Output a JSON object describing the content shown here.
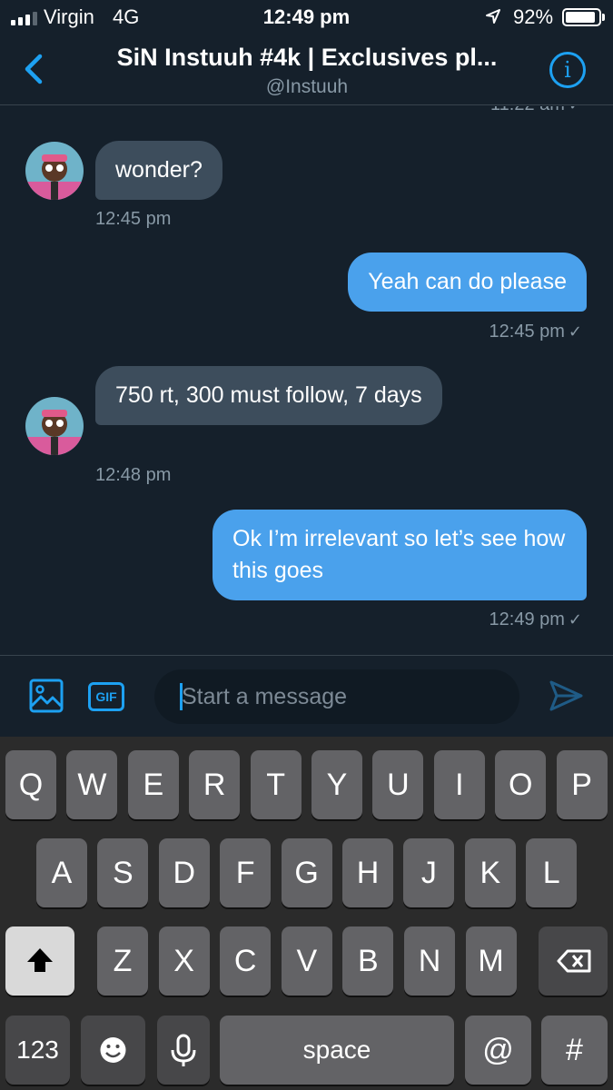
{
  "status_bar": {
    "carrier": "Virgin",
    "network": "4G",
    "time": "12:49 pm",
    "battery_percent": "92%",
    "battery_level": 0.92
  },
  "header": {
    "title": "SiN Instuuh #4k | Exclusives pl...",
    "handle": "@Instuuh",
    "back_icon": "chevron-left-icon",
    "info_icon": "info-icon"
  },
  "messages": {
    "cut_off_time": "11:22 am",
    "items": [
      {
        "direction": "in",
        "text": "wonder?",
        "time": "12:45 pm"
      },
      {
        "direction": "out",
        "text": "Yeah can do please",
        "time": "12:45 pm",
        "read": true
      },
      {
        "direction": "in",
        "text": "750 rt, 300 must follow, 7 days",
        "time": "12:48 pm"
      },
      {
        "direction": "out",
        "text": "Ok I’m irrelevant so let’s see how this goes",
        "time": "12:49 pm",
        "read": true
      }
    ]
  },
  "composer": {
    "placeholder": "Start a message",
    "gif_label": "GIF",
    "image_icon": "image-icon",
    "send_icon": "send-icon"
  },
  "keyboard": {
    "row1": [
      "Q",
      "W",
      "E",
      "R",
      "T",
      "Y",
      "U",
      "I",
      "O",
      "P"
    ],
    "row2": [
      "A",
      "S",
      "D",
      "F",
      "G",
      "H",
      "J",
      "K",
      "L"
    ],
    "row3": [
      "Z",
      "X",
      "C",
      "V",
      "B",
      "N",
      "M"
    ],
    "numbers_label": "123",
    "space_label": "space",
    "at_label": "@",
    "hash_label": "#",
    "shift_icon": "shift-icon",
    "backspace_icon": "backspace-icon",
    "emoji_icon": "emoji-icon",
    "mic_icon": "microphone-icon"
  },
  "colors": {
    "background": "#15202b",
    "accent": "#1da1f2",
    "incoming_bubble": "#3d4d5c",
    "outgoing_bubble": "#4aa1ec",
    "muted_text": "#8899a6"
  }
}
